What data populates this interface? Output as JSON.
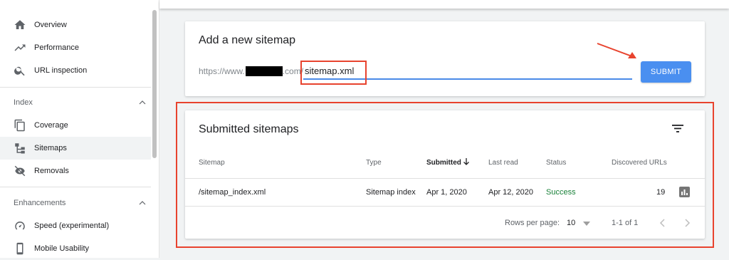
{
  "sidebar": {
    "items_top": [
      {
        "label": "Overview",
        "icon": "home-icon"
      },
      {
        "label": "Performance",
        "icon": "trending-up-icon"
      },
      {
        "label": "URL inspection",
        "icon": "search-icon"
      }
    ],
    "index_section": {
      "title": "Index",
      "items": [
        {
          "label": "Coverage",
          "icon": "copy-icon"
        },
        {
          "label": "Sitemaps",
          "icon": "sitemap-icon"
        },
        {
          "label": "Removals",
          "icon": "eye-off-icon"
        }
      ]
    },
    "enhancements_section": {
      "title": "Enhancements",
      "items": [
        {
          "label": "Speed (experimental)",
          "icon": "speedometer-icon"
        },
        {
          "label": "Mobile Usability",
          "icon": "phone-icon"
        }
      ]
    }
  },
  "add_sitemap": {
    "title": "Add a new sitemap",
    "url_prefix_start": "https://www.",
    "url_prefix_end": ".com/",
    "input_value": "sitemap.xml",
    "submit_label": "SUBMIT"
  },
  "submitted": {
    "title": "Submitted sitemaps",
    "columns": [
      "Sitemap",
      "Type",
      "Submitted",
      "Last read",
      "Status",
      "Discovered URLs"
    ],
    "rows": [
      {
        "sitemap": "/sitemap_index.xml",
        "type": "Sitemap index",
        "submitted": "Apr 1, 2020",
        "last_read": "Apr 12, 2020",
        "status": "Success",
        "discovered_urls": "19"
      }
    ],
    "rows_per_page_label": "Rows per page:",
    "rows_per_page_value": "10",
    "range_text": "1-1 of 1"
  },
  "colors": {
    "accent_blue": "#4a8ff0",
    "success_green": "#188038",
    "annotation_red": "#e8432e"
  }
}
